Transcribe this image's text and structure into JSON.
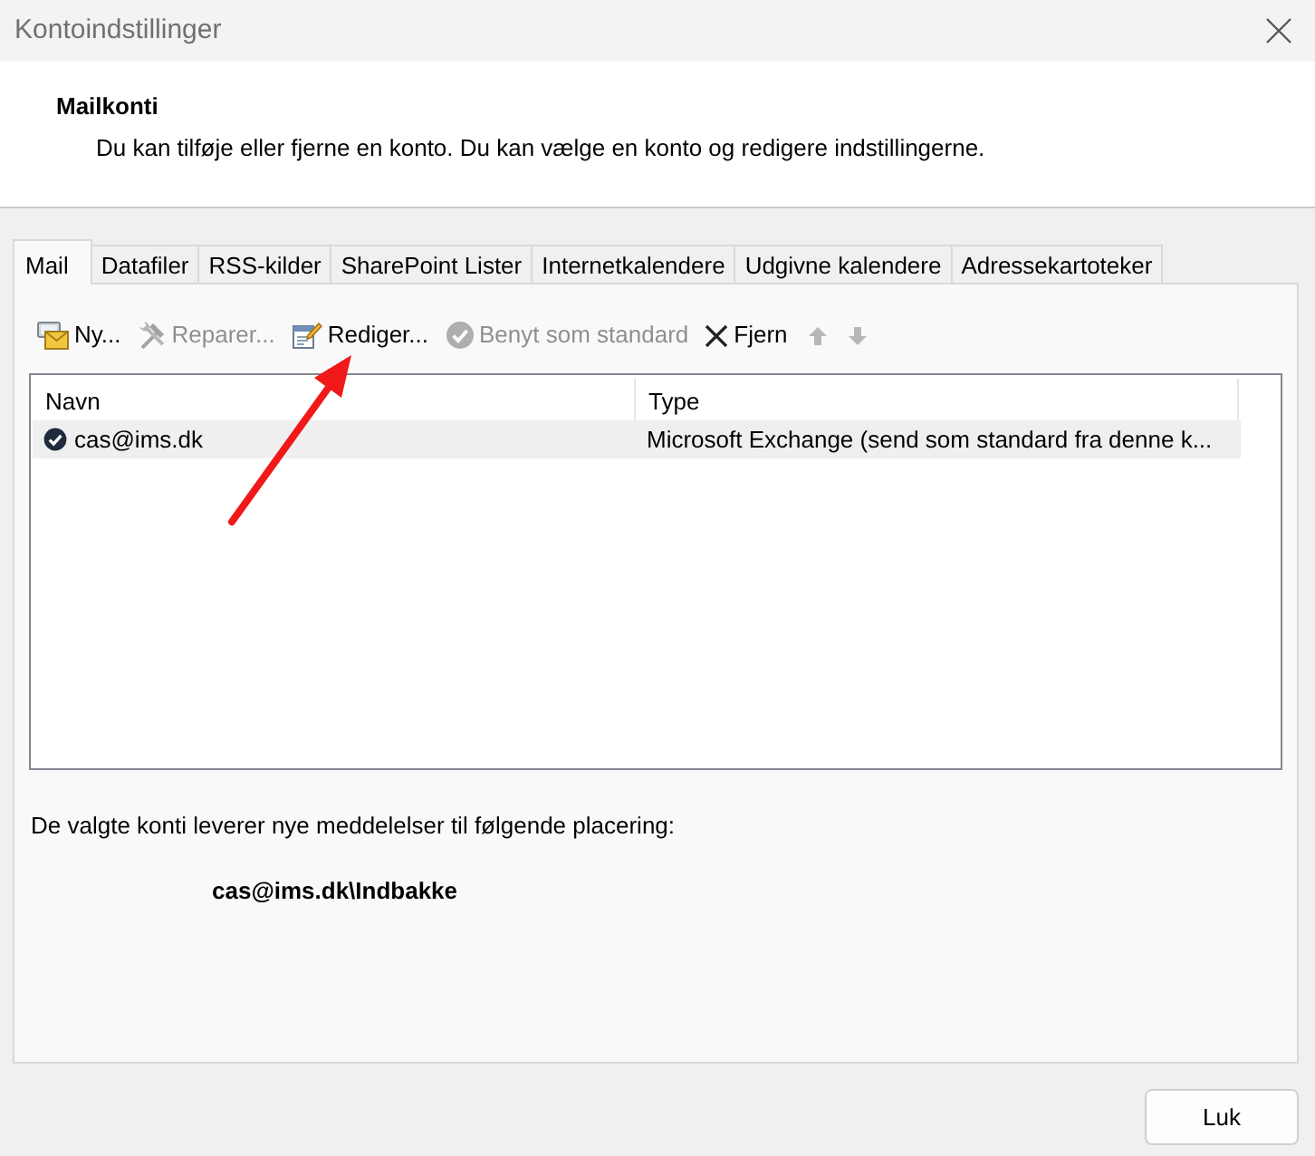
{
  "window": {
    "title": "Kontoindstillinger"
  },
  "header": {
    "title": "Mailkonti",
    "description": "Du kan tilføje eller fjerne en konto. Du kan vælge en konto og redigere indstillingerne."
  },
  "tabs": [
    {
      "label": "Mail",
      "selected": true
    },
    {
      "label": "Datafiler",
      "selected": false
    },
    {
      "label": "RSS-kilder",
      "selected": false
    },
    {
      "label": "SharePoint Lister",
      "selected": false
    },
    {
      "label": "Internetkalendere",
      "selected": false
    },
    {
      "label": "Udgivne kalendere",
      "selected": false
    },
    {
      "label": "Adressekartoteker",
      "selected": false
    }
  ],
  "toolbar": [
    {
      "kind": "new",
      "label": "Ny...",
      "disabled": false
    },
    {
      "kind": "repair",
      "label": "Reparer...",
      "disabled": true
    },
    {
      "kind": "edit",
      "label": "Rediger...",
      "disabled": false
    },
    {
      "kind": "default",
      "label": "Benyt som standard",
      "disabled": true
    },
    {
      "kind": "remove",
      "label": "Fjern",
      "disabled": false
    },
    {
      "kind": "up",
      "disabled": true
    },
    {
      "kind": "down",
      "disabled": true
    }
  ],
  "accounts": {
    "columns": [
      "Navn",
      "Type"
    ],
    "rows": [
      {
        "name": "cas@ims.dk",
        "type": "Microsoft Exchange (send som standard fra denne k...",
        "selected": true,
        "default": true
      }
    ]
  },
  "delivery": {
    "label": "De valgte konti leverer nye meddelelser til følgende placering:",
    "location": "cas@ims.dk\\Indbakke"
  },
  "buttons": [
    {
      "label": "Luk"
    }
  ]
}
